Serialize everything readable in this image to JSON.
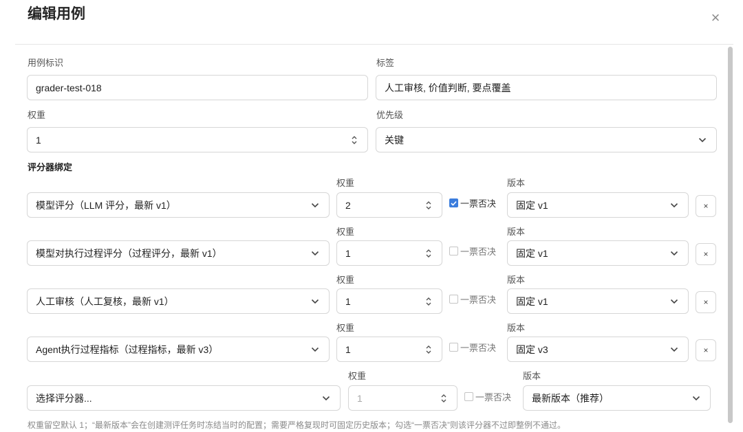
{
  "dialog": {
    "title": "编辑用例",
    "close_symbol": "×"
  },
  "form": {
    "case_id_label": "用例标识",
    "case_id_value": "grader-test-018",
    "tags_label": "标签",
    "tags_value": "人工审核, 价值判断, 要点覆盖",
    "weight_label": "权重",
    "weight_value": "1",
    "priority_label": "优先级",
    "priority_value": "关键",
    "graders_section_label": "评分器绑定"
  },
  "graders": [
    {
      "weight_label": "权重",
      "version_label": "版本",
      "grader": "模型评分（LLM 评分，最新 v1）",
      "weight": "2",
      "veto_label": "一票否决",
      "veto_checked": true,
      "version": "固定 v1",
      "remove_symbol": "×"
    },
    {
      "weight_label": "权重",
      "version_label": "版本",
      "grader": "模型对执行过程评分（过程评分，最新 v1）",
      "weight": "1",
      "veto_label": "一票否决",
      "veto_checked": false,
      "version": "固定 v1",
      "remove_symbol": "×"
    },
    {
      "weight_label": "权重",
      "version_label": "版本",
      "grader": "人工审核（人工复核，最新 v1）",
      "weight": "1",
      "veto_label": "一票否决",
      "veto_checked": false,
      "version": "固定 v1",
      "remove_symbol": "×"
    },
    {
      "weight_label": "权重",
      "version_label": "版本",
      "grader": "Agent执行过程指标（过程指标，最新 v3）",
      "weight": "1",
      "veto_label": "一票否决",
      "veto_checked": false,
      "version": "固定 v3",
      "remove_symbol": "×"
    }
  ],
  "new_grader": {
    "weight_label": "权重",
    "version_label": "版本",
    "grader_placeholder": "选择评分器...",
    "weight_placeholder": "1",
    "veto_label": "一票否决",
    "version": "最新版本（推荐）"
  },
  "footnote": "权重留空默认 1；“最新版本”会在创建测评任务时冻结当时的配置；需要严格复现时可固定历史版本；勾选“一票否决”则该评分器不过即整例不通过。",
  "colors": {
    "accent": "#3b7ddd",
    "border": "#d6d6d6",
    "muted_text": "#8a8a8a"
  },
  "icons": {
    "close": "close-icon",
    "dropdown": "chevron-down-icon",
    "number": "stepper-icon",
    "check": "check-icon"
  }
}
